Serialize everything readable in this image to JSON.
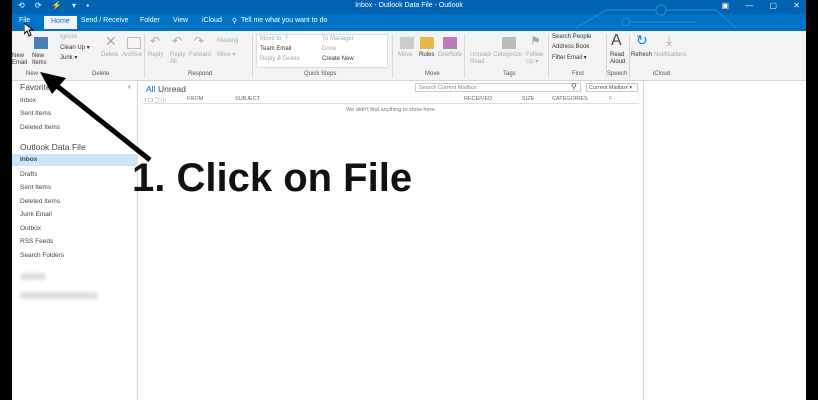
{
  "titlebar": {
    "title": "Inbox - Outlook Data File  -  Outlook",
    "quick_access": "⟲ ⟳ ⚡ ▾ ▪",
    "window_controls": "▣ — ▢ ✕"
  },
  "tabs": [
    "File",
    "Home",
    "Send / Receive",
    "Folder",
    "View",
    "iCloud"
  ],
  "tell_me": "Tell me what you want to do",
  "ribbon": {
    "new_email": "New\nEmail",
    "new_items": "New\nItems",
    "ignore": "Ignore",
    "clean_up": "Clean Up ▾",
    "junk": "Junk ▾",
    "delete": "Delete",
    "archive": "Archive",
    "reply": "Reply",
    "reply_all": "Reply\nAll",
    "forward": "Forward",
    "meeting": "Meeting",
    "more": "More ▾",
    "move_to": "Move to: ?",
    "team_email": "Team Email",
    "reply_delete": "Reply & Delete",
    "to_manager": "To Manager",
    "done": "Done",
    "create_new": "Create New",
    "move": "Move",
    "rules": "Rules",
    "onenote": "OneNote",
    "unread_read": "Unread/\nRead",
    "categorize": "Categorize",
    "follow_up": "Follow\nUp ▾",
    "search_people": "Search People",
    "address_book": "Address Book",
    "filter_email": "Filter Email ▾",
    "read_aloud": "Read\nAloud",
    "refresh": "Refresh",
    "notifications": "Notifications",
    "groups": [
      "New",
      "Delete",
      "Respond",
      "Quick Steps",
      "Move",
      "Tags",
      "Find",
      "Speech",
      "iCloud"
    ]
  },
  "folders": {
    "favorites_header": "Favorites",
    "favorites": [
      "Inbox",
      "Sent Items",
      "Deleted Items"
    ],
    "data_file_header": "Outlook Data File",
    "items": [
      "Inbox",
      "Drafts",
      "Sent Items",
      "Deleted Items",
      "Junk Email",
      "Outbox",
      "RSS Feeds",
      "Search Folders"
    ],
    "selected": "Inbox"
  },
  "message_list": {
    "filter_all": "All",
    "filter_unread": "Unread",
    "search_placeholder": "Search Current Mailbox",
    "scope": "Current Mailbox ▾",
    "columns": [
      "! ☐ 🗋 ⓘ",
      "FROM",
      "SUBJECT",
      "RECEIVED",
      "SIZE",
      "CATEGORIES",
      "⚐"
    ],
    "empty_text": "We didn't find anything to show here."
  },
  "overlay": {
    "callout": "1. Click on File"
  },
  "colors": {
    "titlebar": "#0063b1",
    "tabbar": "#0072c6",
    "ribbon": "#f3f3f3",
    "selected_folder": "#cde6f7"
  }
}
